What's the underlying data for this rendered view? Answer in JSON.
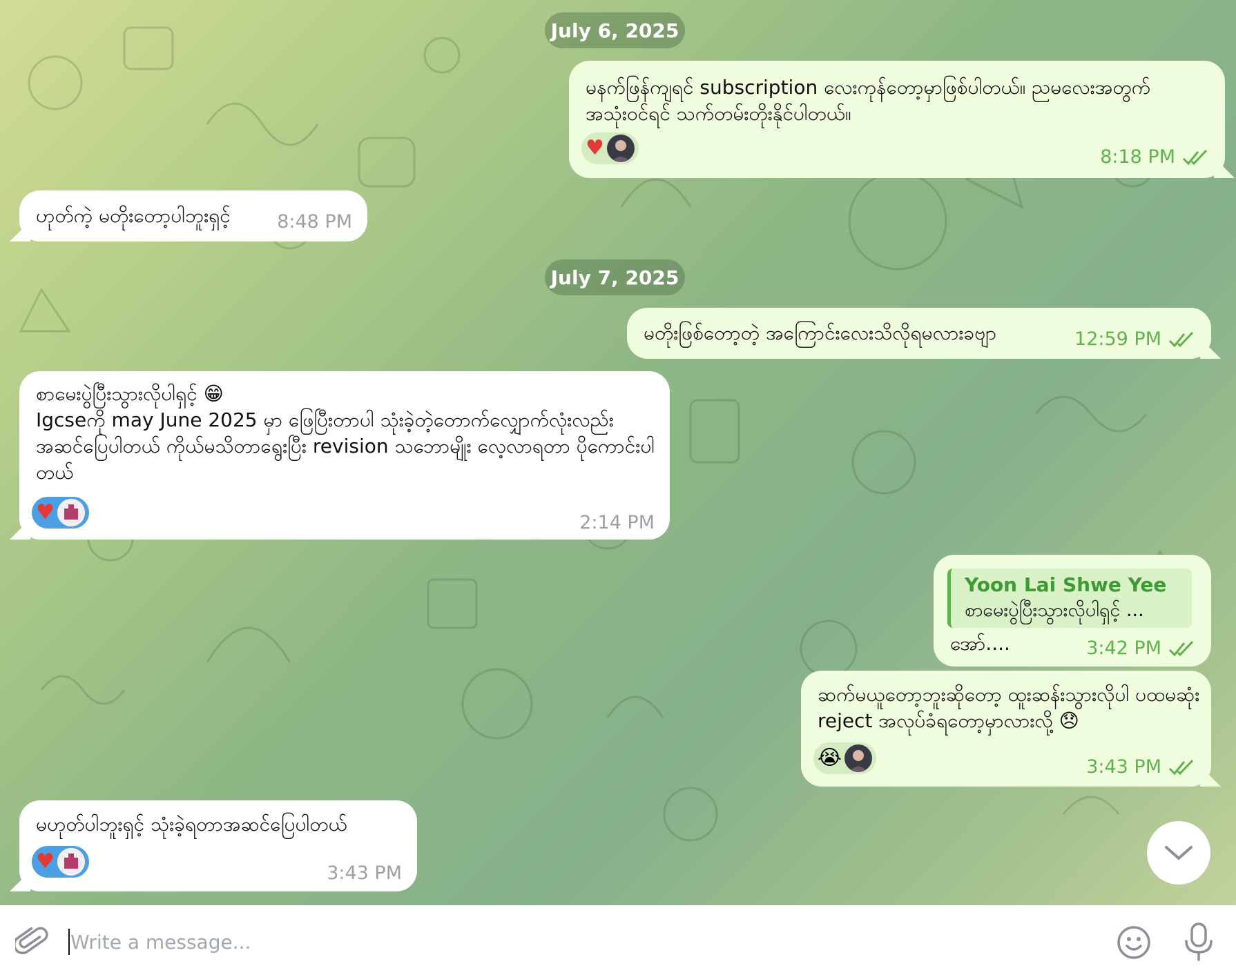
{
  "dates": [
    "July 6, 2025",
    "July 7, 2025"
  ],
  "messages": [
    {
      "id": "m1",
      "dir": "out",
      "text": "မနက်ဖြန်ကျရင် subscription လေးကုန်တော့မှာဖြစ်ပါတယ်။ ညမလေးအတွက် အသုံးဝင်ရင် သက်တမ်းတိုးနိုင်ပါတယ်။",
      "time": "8:18 PM",
      "reactions": [
        "heart",
        "avatar"
      ]
    },
    {
      "id": "m2",
      "dir": "in",
      "text": "ဟုတ်ကဲ့ မတိုးတော့ပါဘူးရှင့်",
      "time": "8:48 PM"
    },
    {
      "id": "m3",
      "dir": "out",
      "text": "မတိုးဖြစ်တော့တဲ့ အကြောင်းလေးသိလိုရမလားခဗျာ",
      "time": "12:59 PM"
    },
    {
      "id": "m4",
      "dir": "in",
      "text": "စာမေးပွဲပြီးသွားလိုပါရှင့် 😁\nIgcseကို may June 2025 မှာ ဖြေပြီးတာပါ သုံးခဲ့တဲ့တောက်လျှောက်လုံးလည်း အဆင်ပြေပါတယ် ကိုယ်မသိတာရွေးပြီး revision သဘောမျိုး လေ့လာရတာ ပိုကောင်းပါတယ်",
      "time": "2:14 PM",
      "reactions": [
        "heart",
        "avatar"
      ]
    },
    {
      "id": "m5",
      "dir": "out",
      "reply_name": "Yoon Lai Shwe Yee",
      "reply_text": "စာမေးပွဲပြီးသွားလိုပါရှင့် ...",
      "text": "အော်....",
      "time": "3:42 PM"
    },
    {
      "id": "m6",
      "dir": "out",
      "text": "ဆက်မယူတော့ဘူးဆိုတော့ ထူးဆန်းသွားလိုပါ ပထမဆုံး reject အလုပ်ခံရတော့မှာလားလို့ 😞",
      "time": "3:43 PM",
      "reactions": [
        "crying-face",
        "avatar"
      ]
    },
    {
      "id": "m7",
      "dir": "in",
      "text": "မဟုတ်ပါဘူးရှင့် သုံးခဲ့ရတာအဆင်ပြေပါတယ်",
      "time": "3:43 PM",
      "reactions": [
        "heart",
        "avatar"
      ]
    }
  ],
  "composer": {
    "placeholder": "Write a message..."
  },
  "icons": {
    "attach": "paperclip-icon",
    "emoji": "smiley-icon",
    "mic": "microphone-icon",
    "scroll": "chevron-down-icon",
    "read": "double-check-icon"
  },
  "colors": {
    "outgoing_bubble": "#effdde",
    "incoming_bubble": "#ffffff",
    "accent_green": "#5fb24a",
    "reaction_blue": "#4d9fe3"
  }
}
